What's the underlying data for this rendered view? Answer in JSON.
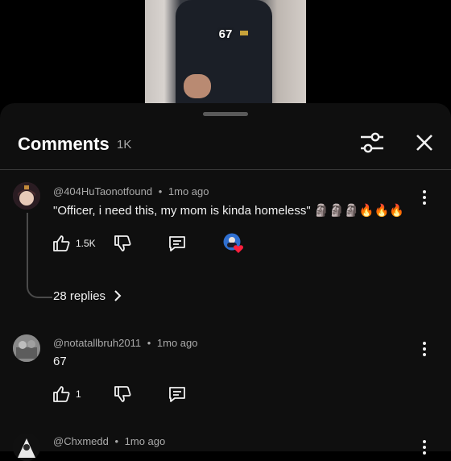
{
  "video": {
    "overlay_text": "67"
  },
  "header": {
    "title": "Comments",
    "count": "1K",
    "filter_icon": "sliders-icon",
    "close_icon": "close-icon"
  },
  "comments": [
    {
      "author": "@404HuTaonotfound",
      "time": "1mo ago",
      "separator": "•",
      "text": "\"Officer, i need this, my mom is kinda homeless\" 🗿🗿🗿🔥🔥🔥",
      "likes": "1.5K",
      "replies_label": "28 replies",
      "has_creator_heart": true
    },
    {
      "author": "@notatallbruh2011",
      "time": "1mo ago",
      "separator": "•",
      "text": "67",
      "likes": "1"
    },
    {
      "author": "@Chxmedd",
      "time": "1mo ago",
      "separator": "•"
    }
  ],
  "colors": {
    "sheet_bg": "#0f0f0f",
    "text": "#f1f1f1",
    "secondary": "#aaaaaa",
    "heart": "#ff1f3d"
  }
}
